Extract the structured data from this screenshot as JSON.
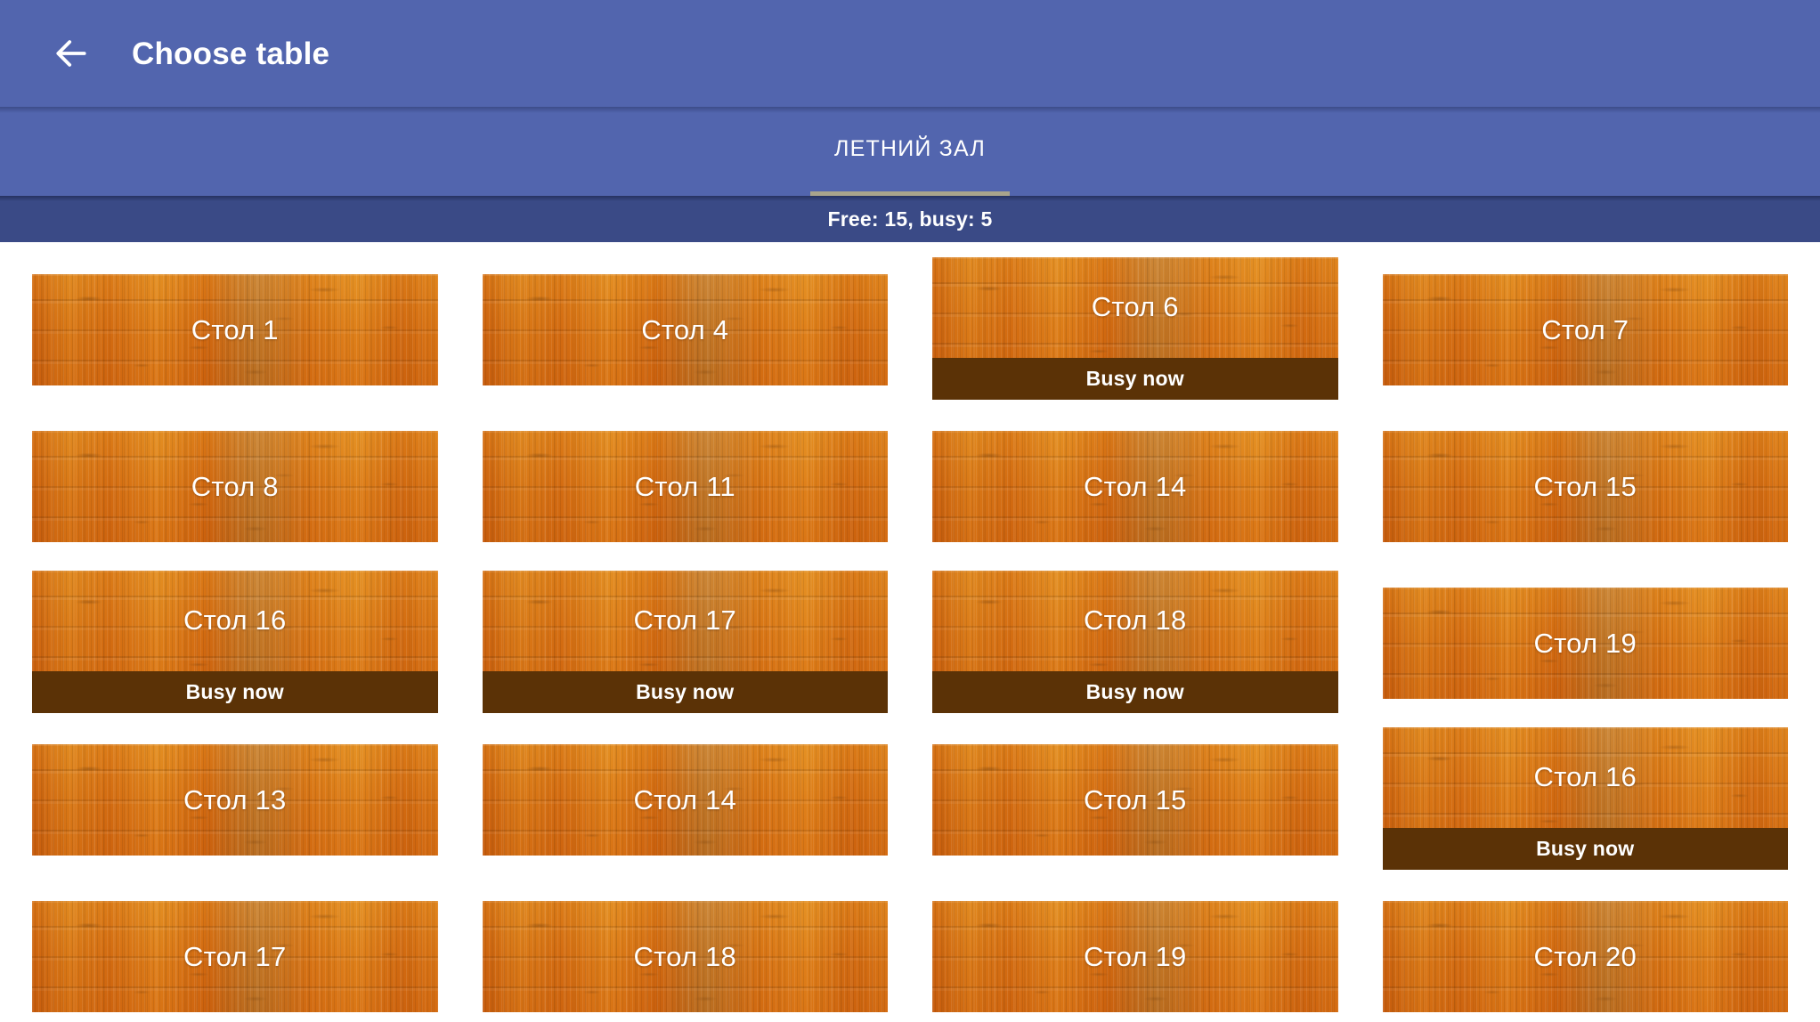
{
  "appbar": {
    "back_icon": "arrow-left-icon",
    "title": "Choose table"
  },
  "tabs": [
    {
      "label": "ЛЕТНИЙ ЗАЛ",
      "selected": true
    }
  ],
  "status": {
    "text": "Free: 15, busy: 5",
    "free_count": 15,
    "busy_count": 5
  },
  "colors": {
    "appbar": "#5265AE",
    "tabbar": "#5265AE",
    "tab_indicator": "#a9a48c",
    "statusbar": "#3A4A86",
    "busy_strip": "#5B3206",
    "wood": "#b97c35",
    "text_on_dark": "#ffffff",
    "page_background": "#ffffff"
  },
  "grid": {
    "columns": 4,
    "busy_badge_label": "Busy now",
    "tables": [
      {
        "name": "Стол 1",
        "busy": false
      },
      {
        "name": "Стол 4",
        "busy": false
      },
      {
        "name": "Стол 6",
        "busy": true
      },
      {
        "name": "Стол 7",
        "busy": false
      },
      {
        "name": "Стол 8",
        "busy": false
      },
      {
        "name": "Стол 11",
        "busy": false
      },
      {
        "name": "Стол 14",
        "busy": false
      },
      {
        "name": "Стол 15",
        "busy": false
      },
      {
        "name": "Стол 16",
        "busy": true
      },
      {
        "name": "Стол 17",
        "busy": true
      },
      {
        "name": "Стол 18",
        "busy": true
      },
      {
        "name": "Стол 19",
        "busy": false
      },
      {
        "name": "Стол 13",
        "busy": false
      },
      {
        "name": "Стол 14",
        "busy": false
      },
      {
        "name": "Стол 15",
        "busy": false
      },
      {
        "name": "Стол 16",
        "busy": true
      },
      {
        "name": "Стол 17",
        "busy": false
      },
      {
        "name": "Стол 18",
        "busy": false
      },
      {
        "name": "Стол 19",
        "busy": false
      },
      {
        "name": "Стол 20",
        "busy": false
      }
    ]
  }
}
